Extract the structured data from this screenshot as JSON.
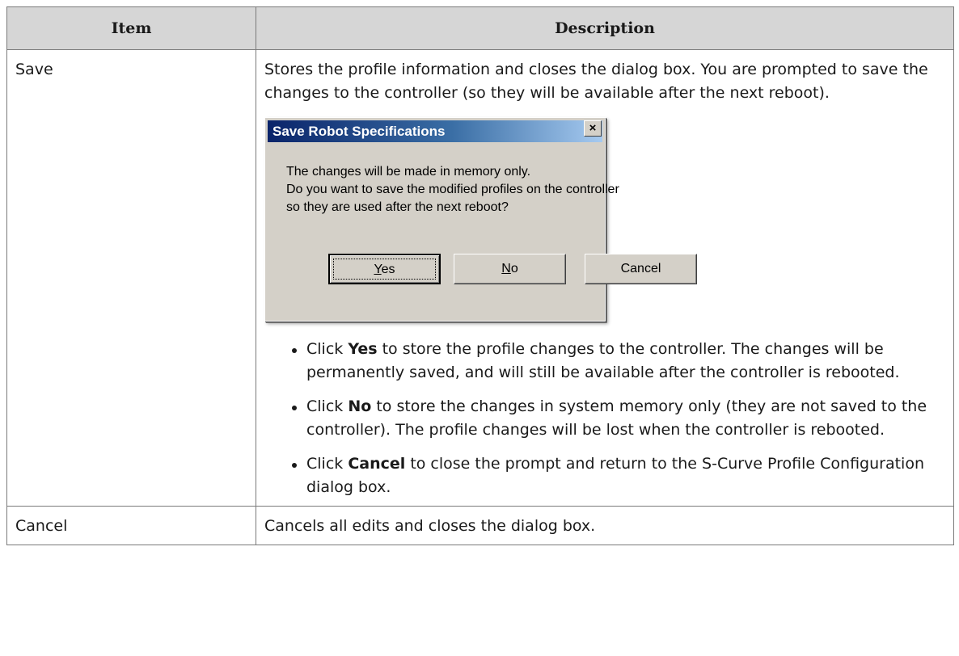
{
  "table": {
    "headers": {
      "item": "Item",
      "description": "Description"
    },
    "rows": [
      {
        "item": "Save",
        "description": "Stores the profile information and closes the dialog box. You are prompted to save the changes to the controller (so they will be available after the next reboot).",
        "dialog": {
          "title": "Save Robot Specifications",
          "close_glyph": "×",
          "message_lines": [
            "The changes will be made in memory only.",
            "Do you want to save the modified profiles on the controller",
            "so they are used after the next reboot?"
          ],
          "buttons": {
            "yes_accel": "Y",
            "yes_rest": "es",
            "no_accel": "N",
            "no_rest": "o",
            "cancel": "Cancel"
          }
        },
        "bullets": [
          {
            "pre": "Click ",
            "keyword": "Yes",
            "post": " to store the profile changes to the controller. The changes will be permanently saved, and will still be available after the controller is rebooted."
          },
          {
            "pre": "Click ",
            "keyword": "No",
            "post": " to store the changes in system memory only (they are not saved to the controller). The profile changes will be lost when the controller is rebooted."
          },
          {
            "pre": "Click ",
            "keyword": "Cancel",
            "post": " to close the prompt and return to the S-Curve Profile Configuration dialog box."
          }
        ]
      },
      {
        "item": "Cancel",
        "description": "Cancels all edits and closes the dialog box."
      }
    ]
  }
}
